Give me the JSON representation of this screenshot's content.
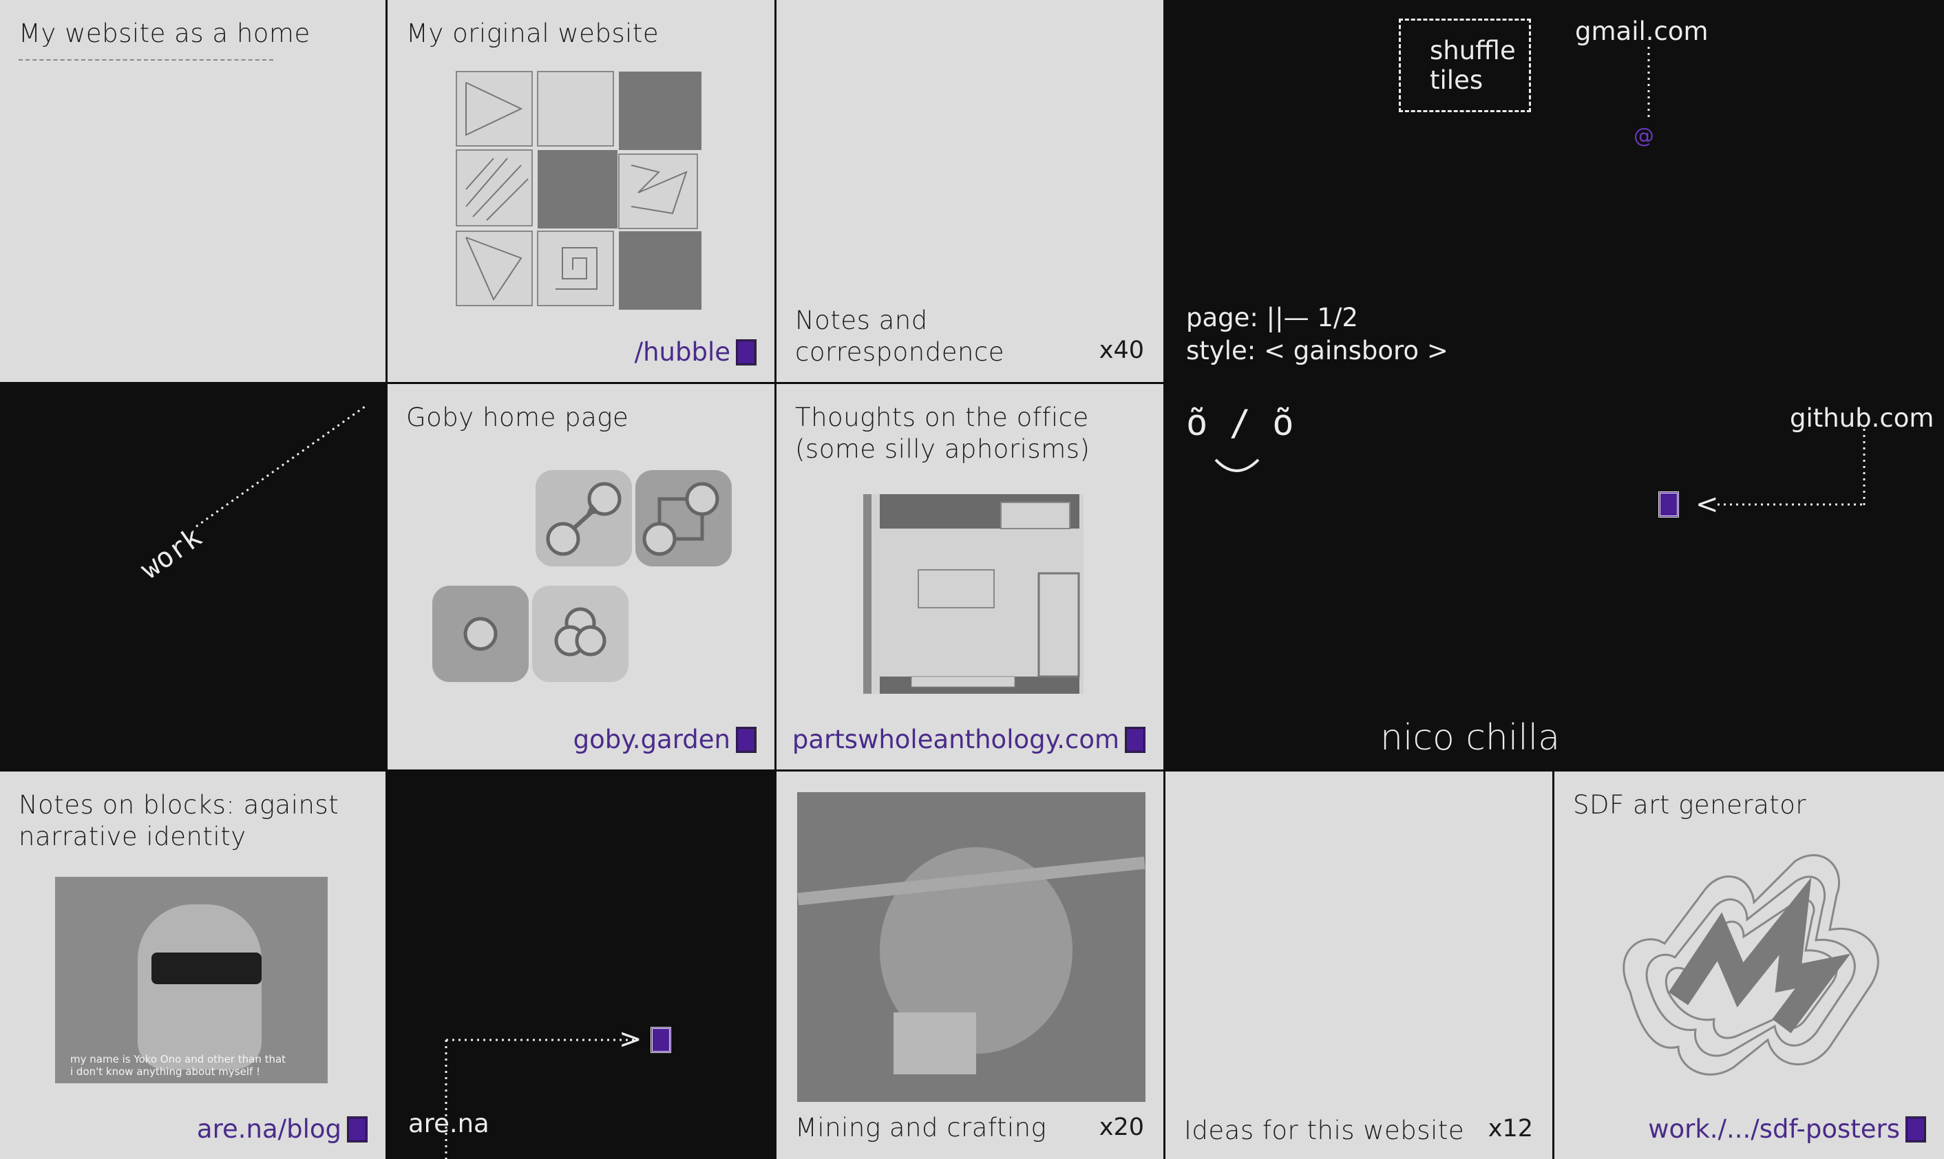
{
  "colors": {
    "light": "#dcdcdc",
    "dark": "#0f0f0f",
    "accent": "#4b1e96",
    "link": "#4a2a8a",
    "grey": "#777777"
  },
  "tiles": {
    "home": {
      "title": "My website as a home"
    },
    "original": {
      "title": "My original website",
      "link": "/hubble"
    },
    "notes": {
      "title": "Notes and\ncorrespondence",
      "count": "x40"
    },
    "goby": {
      "title": "Goby home page",
      "link": "goby.garden"
    },
    "office": {
      "title": "Thoughts on the office\n(some silly aphorisms)",
      "link": "partswholeanthology.com"
    },
    "work": {
      "label": "work"
    },
    "blocks": {
      "title": "Notes on blocks: against\nnarrative identity",
      "link": "are.na/blog",
      "caption": "my name is Yoko Ono and other than that\ni don't know anything about myself !"
    },
    "arena": {
      "label": "are.na"
    },
    "mining": {
      "title": "Mining and crafting",
      "count": "x20"
    },
    "ideas": {
      "title": "Ideas for this website",
      "count": "x12"
    },
    "sdf": {
      "title": "SDF art generator",
      "link": "work./.../sdf-posters"
    }
  },
  "panel": {
    "shuffle": "shuffle\ntiles",
    "gmail": "gmail.com",
    "at_icon": "@",
    "page_label": "page:",
    "page_value": "||— 1/2",
    "style_label": "style:",
    "style_value": "< gainsboro >",
    "face": "õ / õ",
    "github": "github.com",
    "name": "nico chilla",
    "arrow_left": "<",
    "arrow_right": ">"
  }
}
